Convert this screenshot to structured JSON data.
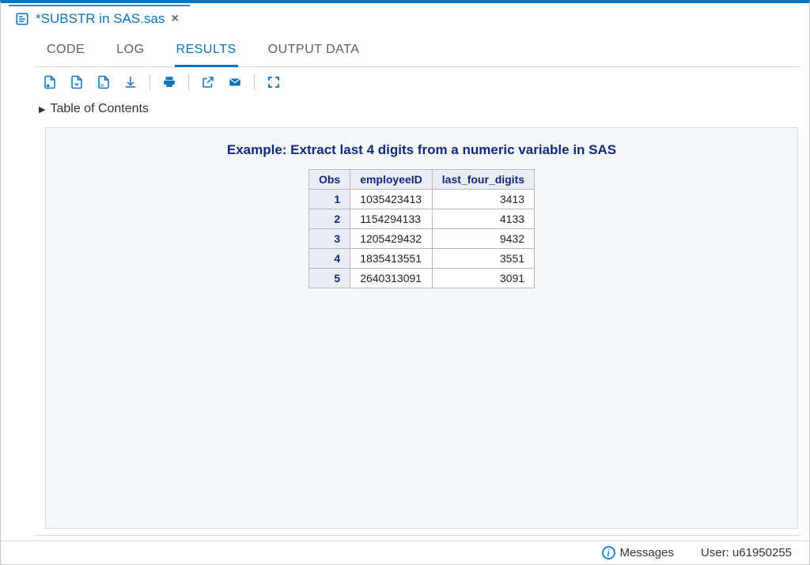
{
  "file_tab": {
    "title": "*SUBSTR in SAS.sas"
  },
  "sub_tabs": {
    "code": "CODE",
    "log": "LOG",
    "results": "RESULTS",
    "output_data": "OUTPUT DATA"
  },
  "toc": {
    "label": "Table of Contents"
  },
  "results": {
    "title": "Example: Extract last 4 digits from a numeric variable in SAS",
    "columns": {
      "obs": "Obs",
      "employeeID": "employeeID",
      "last_four": "last_four_digits"
    },
    "rows": [
      {
        "obs": "1",
        "employeeID": "1035423413",
        "last_four": "3413"
      },
      {
        "obs": "2",
        "employeeID": "1154294133",
        "last_four": "4133"
      },
      {
        "obs": "3",
        "employeeID": "1205429432",
        "last_four": "9432"
      },
      {
        "obs": "4",
        "employeeID": "1835413551",
        "last_four": "3551"
      },
      {
        "obs": "5",
        "employeeID": "2640313091",
        "last_four": "3091"
      }
    ]
  },
  "status": {
    "messages_label": "Messages",
    "user_label": "User: u61950255"
  }
}
